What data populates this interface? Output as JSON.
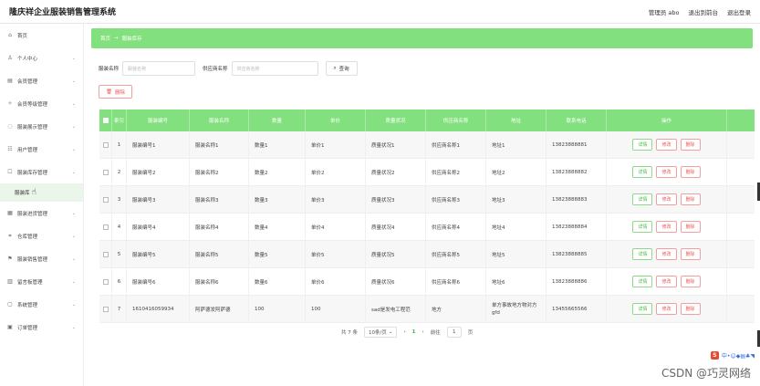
{
  "app": {
    "title": "隆庆祥企业服装销售管理系统"
  },
  "top_nav": {
    "user": "管理员 abo",
    "back_to_front": "退出到前台",
    "logout": "退出登录"
  },
  "sidebar": {
    "items": [
      {
        "label": "首页",
        "icon": "home-icon",
        "glyph": "⌂",
        "chevron": false
      },
      {
        "label": "个人中心",
        "icon": "user-icon",
        "glyph": "♙",
        "chevron": true
      },
      {
        "label": "会员管理",
        "icon": "member-icon",
        "glyph": "▤",
        "chevron": true
      },
      {
        "label": "会员等级管理",
        "icon": "level-icon",
        "glyph": "✧",
        "chevron": true
      },
      {
        "label": "服装展示管理",
        "icon": "display-icon",
        "glyph": "◌",
        "chevron": true
      },
      {
        "label": "用户管理",
        "icon": "users-icon",
        "glyph": "☷",
        "chevron": true
      },
      {
        "label": "服装库存管理",
        "icon": "inventory-icon",
        "glyph": "☐",
        "chevron": true
      }
    ],
    "sub_item": "服装库",
    "items_after": [
      {
        "label": "服装进货管理",
        "icon": "purchase-icon",
        "glyph": "▦",
        "chevron": true
      },
      {
        "label": "仓库管理",
        "icon": "warehouse-icon",
        "glyph": "⌗",
        "chevron": true
      },
      {
        "label": "服装销售管理",
        "icon": "sales-icon",
        "glyph": "⚑",
        "chevron": true
      },
      {
        "label": "留言板管理",
        "icon": "message-icon",
        "glyph": "▥",
        "chevron": true
      },
      {
        "label": "系统管理",
        "icon": "system-icon",
        "glyph": "▢",
        "chevron": true
      },
      {
        "label": "订单管理",
        "icon": "order-icon",
        "glyph": "▣",
        "chevron": true
      }
    ]
  },
  "breadcrumb": {
    "home": "首页",
    "separator": "→",
    "current": "服装库存"
  },
  "search": {
    "name_label": "服装名称",
    "name_placeholder": "服装名称",
    "supplier_label": "供应商名称",
    "supplier_placeholder": "供应商名称",
    "query_button": "查询"
  },
  "delete_button": "删除",
  "table": {
    "headers": [
      "索引",
      "服装编号",
      "服装名称",
      "数量",
      "单价",
      "质量状况",
      "供应商名称",
      "地址",
      "联系电话",
      "操作"
    ],
    "actions": {
      "detail": "详情",
      "edit": "修改",
      "delete": "删除"
    },
    "rows": [
      [
        "1",
        "服装编号1",
        "服装名称1",
        "数量1",
        "单价1",
        "质量状况1",
        "供应商名称1",
        "地址1",
        "13823888881"
      ],
      [
        "2",
        "服装编号2",
        "服装名称2",
        "数量2",
        "单价2",
        "质量状况2",
        "供应商名称2",
        "地址2",
        "13823888882"
      ],
      [
        "3",
        "服装编号3",
        "服装名称3",
        "数量3",
        "单价3",
        "质量状况3",
        "供应商名称3",
        "地址3",
        "13823888883"
      ],
      [
        "4",
        "服装编号4",
        "服装名称4",
        "数量4",
        "单价4",
        "质量状况4",
        "供应商名称4",
        "地址4",
        "13823888884"
      ],
      [
        "5",
        "服装编号5",
        "服装名称5",
        "数量5",
        "单价5",
        "质量状况5",
        "供应商名称5",
        "地址5",
        "13823888885"
      ],
      [
        "6",
        "服装编号6",
        "服装名称6",
        "数量6",
        "单价6",
        "质量状况6",
        "供应商名称6",
        "地址6",
        "13823888886"
      ],
      [
        "7",
        "1610416059934",
        "阿萨德发阿萨德",
        "100",
        "100",
        "sad是发电工程范",
        "地方",
        "单方事故地方物对方gfd",
        "13455665566"
      ]
    ]
  },
  "pagination": {
    "total": "共 7 条",
    "page_size": "10条/页",
    "prev": "‹",
    "current": "1",
    "next": "›",
    "goto": "前往",
    "page_input": "1",
    "page_unit": "页"
  },
  "watermark": "CSDN @巧灵网络",
  "colors": {
    "accent": "#82e07e",
    "danger": "#e85a5a",
    "success": "#41b83c"
  }
}
